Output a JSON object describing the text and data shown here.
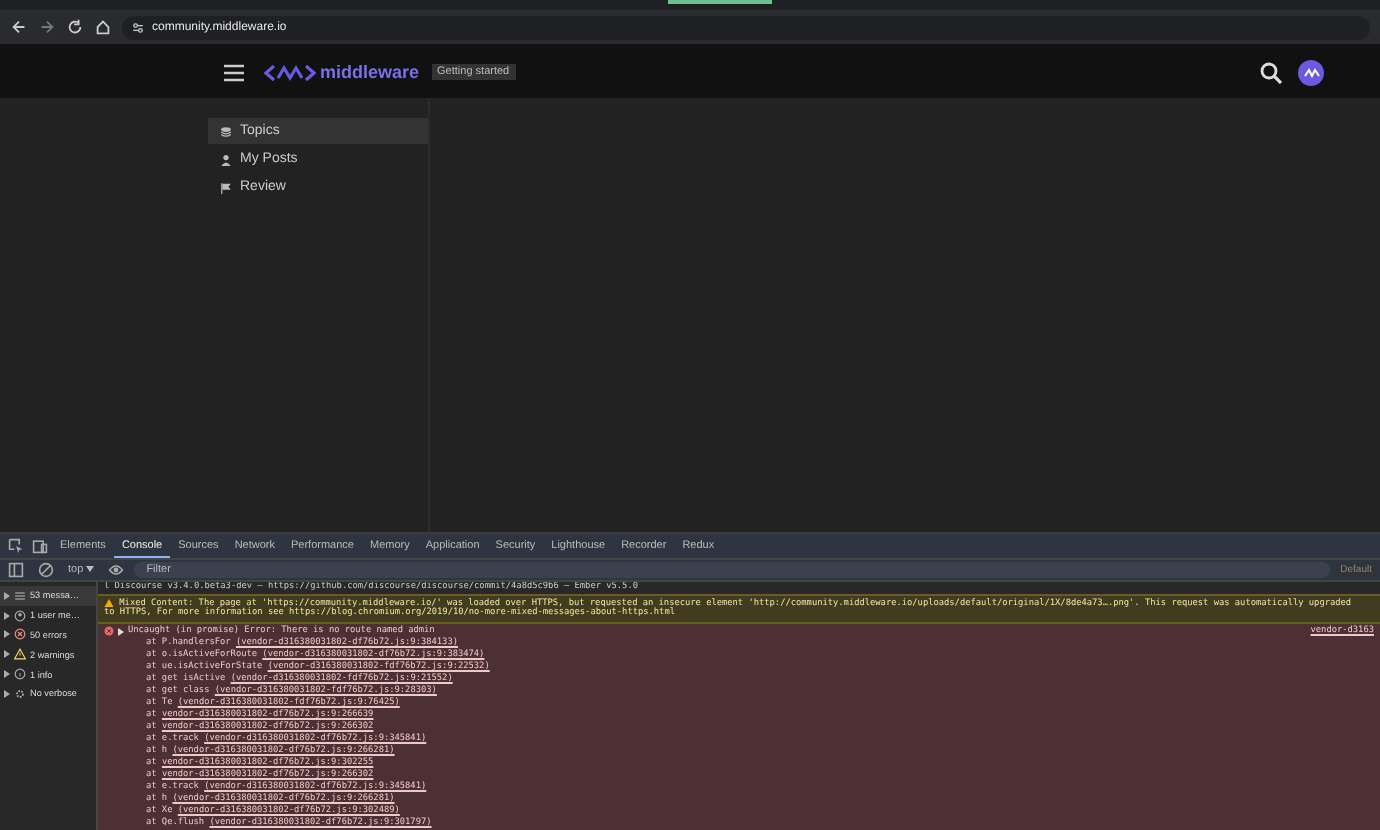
{
  "browser": {
    "url": "community.middleware.io"
  },
  "site": {
    "logo": "middleware",
    "badge": "Getting started",
    "nav": [
      {
        "label": "Topics",
        "kind": "layers",
        "selected": true
      },
      {
        "label": "My Posts",
        "kind": "person",
        "selected": false
      },
      {
        "label": "Review",
        "kind": "flag",
        "selected": false
      }
    ]
  },
  "devtools": {
    "tabs": [
      {
        "label": "Elements",
        "selected": false
      },
      {
        "label": "Console",
        "selected": true
      },
      {
        "label": "Sources",
        "selected": false
      },
      {
        "label": "Network",
        "selected": false
      },
      {
        "label": "Performance",
        "selected": false
      },
      {
        "label": "Memory",
        "selected": false
      },
      {
        "label": "Application",
        "selected": false
      },
      {
        "label": "Security",
        "selected": false
      },
      {
        "label": "Lighthouse",
        "selected": false
      },
      {
        "label": "Recorder",
        "selected": false
      },
      {
        "label": "Redux",
        "selected": false
      }
    ],
    "context": "top",
    "filter_placeholder": "Filter",
    "levels": "Default",
    "sidebar": [
      {
        "label": "53 messa…",
        "kind": "list",
        "selected": true
      },
      {
        "label": "1 user me…",
        "kind": "user",
        "selected": false
      },
      {
        "label": "50 errors",
        "kind": "error",
        "selected": false
      },
      {
        "label": "2 warnings",
        "kind": "warning",
        "selected": false
      },
      {
        "label": "1 info",
        "kind": "info",
        "selected": false
      },
      {
        "label": "No verbose",
        "kind": "verbose",
        "selected": false
      }
    ],
    "messages": [
      {
        "kind": "log",
        "text": "l Discourse v3.4.0.beta3-dev — https://github.com/discourse/discourse/commit/4a8d5c9b6 — Ember v5.5.0"
      },
      {
        "kind": "warning",
        "lines": [
          "Mixed Content: The page at 'https://community.middleware.io/' was loaded over HTTPS, but requested an insecure element 'http://community.middleware.io/uploads/default/original/1X/8de4a73….png'. This request was automatically upgraded",
          "to HTTPS, For more information see https://blog.chromium.org/2019/10/no-more-mixed-messages-about-https.html"
        ]
      },
      {
        "kind": "error",
        "text": "Uncaught (in promise) Error: There is no route named admin",
        "source": "vendor-d3163",
        "stack": [
          {
            "fn": "at P.handlersFor",
            "loc": "(vendor-d316380031802-df76b72.js:9:384133)"
          },
          {
            "fn": "at o.isActiveForRoute",
            "loc": "(vendor-d316380031802-df76b72.js:9:383474)"
          },
          {
            "fn": "at ue.isActiveForState",
            "loc": "(vendor-d316380031802-fdf76b72.js:9:22532)"
          },
          {
            "fn": "at get isActive",
            "loc": "(vendor-d316380031802-fdf76b72.js:9:21552)"
          },
          {
            "fn": "at get class",
            "loc": "(vendor-d316380031802-fdf76b72.js:9:28303)"
          },
          {
            "fn": "at Te",
            "loc": "(vendor-d316380031802-fdf76b72.js:9:76425)"
          },
          {
            "fn": "at",
            "loc": "vendor-d316380031802-df76b72.js:9:266639"
          },
          {
            "fn": "at",
            "loc": "vendor-d316380031802-df76b72.js:9:266302"
          },
          {
            "fn": "at e.track",
            "loc": "(vendor-d316380031802-df76b72.js:9:345841)"
          },
          {
            "fn": "at h",
            "loc": "(vendor-d316380031802-df76b72.js:9:266281)"
          },
          {
            "fn": "at",
            "loc": "vendor-d316380031802-df76b72.js:9:302255"
          },
          {
            "fn": "at",
            "loc": "vendor-d316380031802-df76b72.js:9:266302"
          },
          {
            "fn": "at e.track",
            "loc": "(vendor-d316380031802-df76b72.js:9:345841)"
          },
          {
            "fn": "at h",
            "loc": "(vendor-d316380031802-df76b72.js:9:266281)"
          },
          {
            "fn": "at Xe",
            "loc": "(vendor-d316380031802-df76b72.js:9:302489)"
          },
          {
            "fn": "at Qe.flush",
            "loc": "(vendor-d316380031802-df76b72.js:9:301797)"
          }
        ]
      }
    ]
  }
}
